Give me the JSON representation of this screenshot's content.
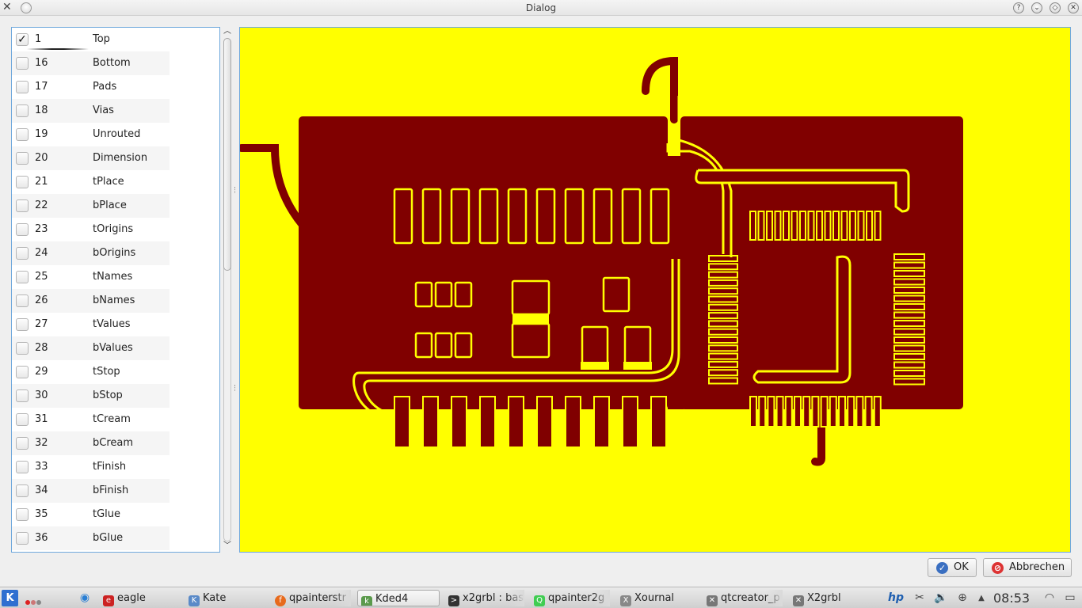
{
  "window": {
    "title": "Dialog",
    "app_icon": "x-tools-icon",
    "buttons": [
      "help-icon",
      "minimize-icon",
      "maximize-icon",
      "close-icon"
    ]
  },
  "layers": [
    {
      "num": "1",
      "name": "Top",
      "checked": true
    },
    {
      "num": "16",
      "name": "Bottom",
      "checked": false
    },
    {
      "num": "17",
      "name": "Pads",
      "checked": false
    },
    {
      "num": "18",
      "name": "Vias",
      "checked": false
    },
    {
      "num": "19",
      "name": "Unrouted",
      "checked": false
    },
    {
      "num": "20",
      "name": "Dimension",
      "checked": false
    },
    {
      "num": "21",
      "name": "tPlace",
      "checked": false
    },
    {
      "num": "22",
      "name": "bPlace",
      "checked": false
    },
    {
      "num": "23",
      "name": "tOrigins",
      "checked": false
    },
    {
      "num": "24",
      "name": "bOrigins",
      "checked": false
    },
    {
      "num": "25",
      "name": "tNames",
      "checked": false
    },
    {
      "num": "26",
      "name": "bNames",
      "checked": false
    },
    {
      "num": "27",
      "name": "tValues",
      "checked": false
    },
    {
      "num": "28",
      "name": "bValues",
      "checked": false
    },
    {
      "num": "29",
      "name": "tStop",
      "checked": false
    },
    {
      "num": "30",
      "name": "bStop",
      "checked": false
    },
    {
      "num": "31",
      "name": "tCream",
      "checked": false
    },
    {
      "num": "32",
      "name": "bCream",
      "checked": false
    },
    {
      "num": "33",
      "name": "tFinish",
      "checked": false
    },
    {
      "num": "34",
      "name": "bFinish",
      "checked": false
    },
    {
      "num": "35",
      "name": "tGlue",
      "checked": false
    },
    {
      "num": "36",
      "name": "bGlue",
      "checked": false
    }
  ],
  "preview": {
    "background_color": "#ffff00",
    "copper_color": "#800000"
  },
  "dialog_buttons": {
    "ok_label": "OK",
    "cancel_label": "Abbrechen"
  },
  "taskbar": {
    "tasks": [
      {
        "label": "eagle",
        "icon": "eagle-icon"
      },
      {
        "label": "Kate",
        "icon": "kate-icon"
      },
      {
        "label": "qpainterstr",
        "icon": "firefox-icon"
      },
      {
        "label": "Kded4",
        "icon": "kded-icon",
        "active": true
      },
      {
        "label": "x2grbl : bas",
        "icon": "terminal-icon"
      },
      {
        "label": "qpainter2g",
        "icon": "qt-icon"
      },
      {
        "label": "Xournal",
        "icon": "xournal-icon"
      },
      {
        "label": "qtcreator_p",
        "icon": "x-tools-icon"
      },
      {
        "label": "X2grbl",
        "icon": "x-tools-icon"
      }
    ],
    "clock": "08:53"
  }
}
